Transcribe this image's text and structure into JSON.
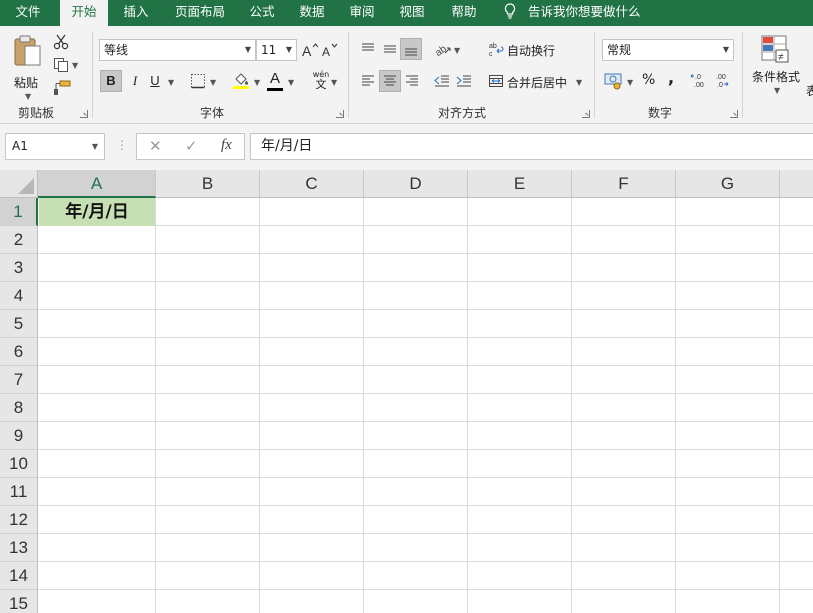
{
  "tabs": {
    "file": "文件",
    "home": "开始",
    "insert": "插入",
    "layout": "页面布局",
    "formulas": "公式",
    "data": "数据",
    "review": "审阅",
    "view": "视图",
    "help": "帮助",
    "tell_me": "告诉我你想要做什么"
  },
  "clipboard": {
    "paste_label": "粘贴",
    "group_label": "剪贴板"
  },
  "font": {
    "name": "等线",
    "size": "11",
    "bold": "B",
    "italic": "I",
    "underline": "U",
    "font_color_glyph": "A",
    "phonetic_top": "wén",
    "phonetic_bottom": "文",
    "group_label": "字体"
  },
  "alignment": {
    "wrap_text": "自动换行",
    "merge_center": "合并后居中",
    "group_label": "对齐方式"
  },
  "number": {
    "format": "常规",
    "percent": "%",
    "comma": ",",
    "inc_decimal": "←.0\n.00",
    "group_label": "数字"
  },
  "styles": {
    "conditional_format": "条件格式",
    "partial_next": "表"
  },
  "formula_bar": {
    "name_box": "A1",
    "cancel": "✕",
    "enter": "✓",
    "fx": "fx",
    "content": "年/月/日"
  },
  "sheet": {
    "columns": [
      "A",
      "B",
      "C",
      "D",
      "E",
      "F",
      "G"
    ],
    "rows": [
      "1",
      "2",
      "3",
      "4",
      "5",
      "6",
      "7",
      "8",
      "9",
      "10",
      "11",
      "12",
      "13",
      "14",
      "15"
    ],
    "a1_value": "年/月/日",
    "a1_fill": "#c6e0b4"
  },
  "colors": {
    "accent": "#217346",
    "ribbon_bg": "#f3f3f3",
    "header_bg": "#e6e6e6"
  }
}
